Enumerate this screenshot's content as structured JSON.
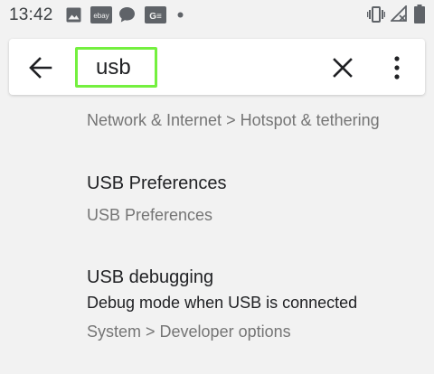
{
  "status_bar": {
    "time": "13:42",
    "left_icons": [
      "image-icon",
      "ebay-icon",
      "chat-bubble-icon",
      "news-icon",
      "dot-icon"
    ],
    "ebay_label": "ebay",
    "news_label": "G≡",
    "right_icons": [
      "vibrate-icon",
      "no-signal-icon",
      "battery-icon"
    ]
  },
  "search": {
    "query": "usb",
    "back_icon": "back-arrow-icon",
    "clear_icon": "close-icon",
    "more_icon": "more-vert-icon",
    "highlight_color": "#74f03f"
  },
  "results": [
    {
      "breadcrumb": "Network & Internet > Hotspot & tethering"
    },
    {
      "title": "USB Preferences",
      "breadcrumb": "USB Preferences"
    },
    {
      "title": "USB debugging",
      "summary": "Debug mode when USB is connected",
      "breadcrumb": "System > Developer options"
    }
  ]
}
